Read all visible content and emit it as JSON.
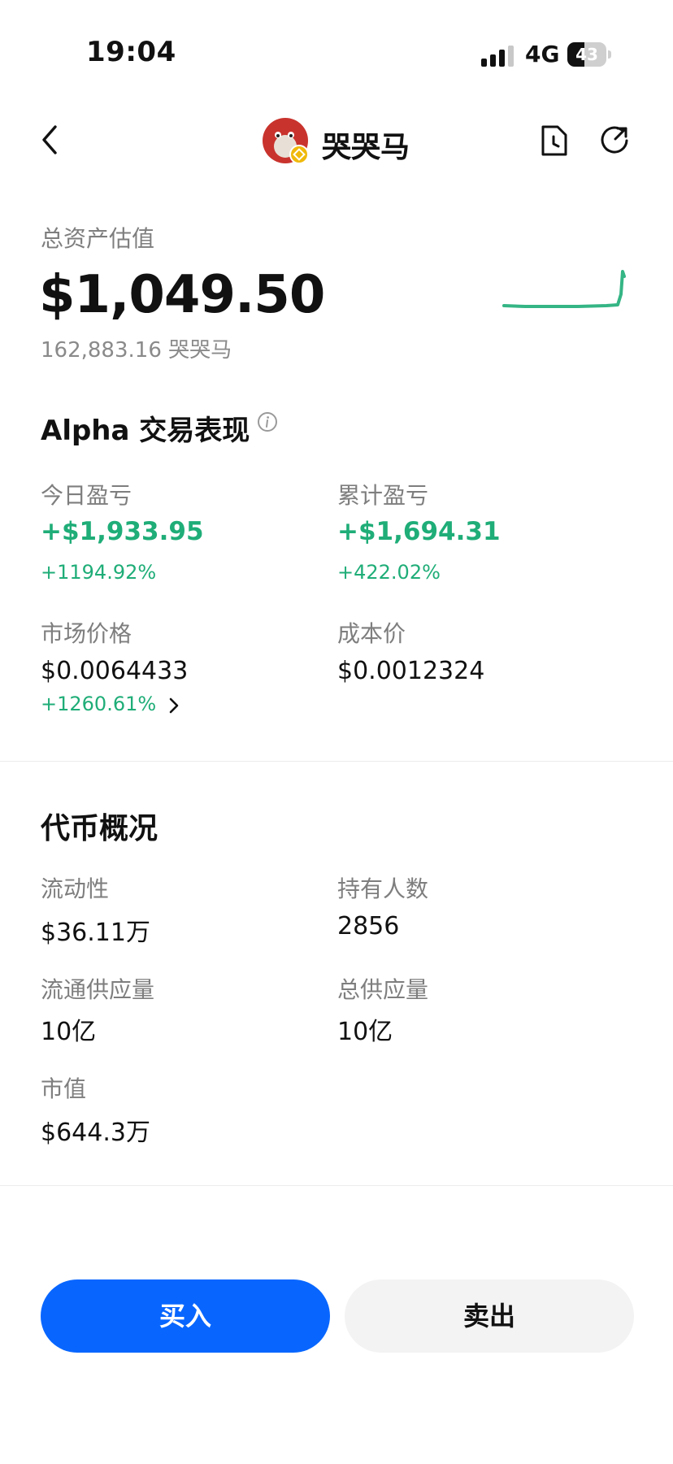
{
  "status_bar": {
    "time": "19:04",
    "network": "4G",
    "battery": "43",
    "battery_level": 0.43
  },
  "nav": {
    "title": "哭哭马"
  },
  "assets": {
    "label": "总资产估值",
    "value": "$1,049.50",
    "quantity": "162,883.16 哭哭马"
  },
  "alpha": {
    "title": "Alpha 交易表现",
    "today_label": "今日盈亏",
    "today_pnl": "+$1,933.95",
    "today_pct": "+1194.92%",
    "total_label": "累计盈亏",
    "total_pnl": "+$1,694.31",
    "total_pct": "+422.02%",
    "market_label": "市场价格",
    "market_price": "$0.0064433",
    "market_change": "+1260.61%",
    "cost_label": "成本价",
    "cost_price": "$0.0012324"
  },
  "overview": {
    "title": "代币概况",
    "liquidity_label": "流动性",
    "liquidity": "$36.11万",
    "holders_label": "持有人数",
    "holders": "2856",
    "circulating_label": "流通供应量",
    "circulating": "10亿",
    "total_supply_label": "总供应量",
    "total_supply": "10亿",
    "market_cap_label": "市值",
    "market_cap": "$644.3万"
  },
  "actions": {
    "buy": "买入",
    "sell": "卖出"
  },
  "colors": {
    "accent": "#0866ff",
    "positive": "#1fad78"
  }
}
